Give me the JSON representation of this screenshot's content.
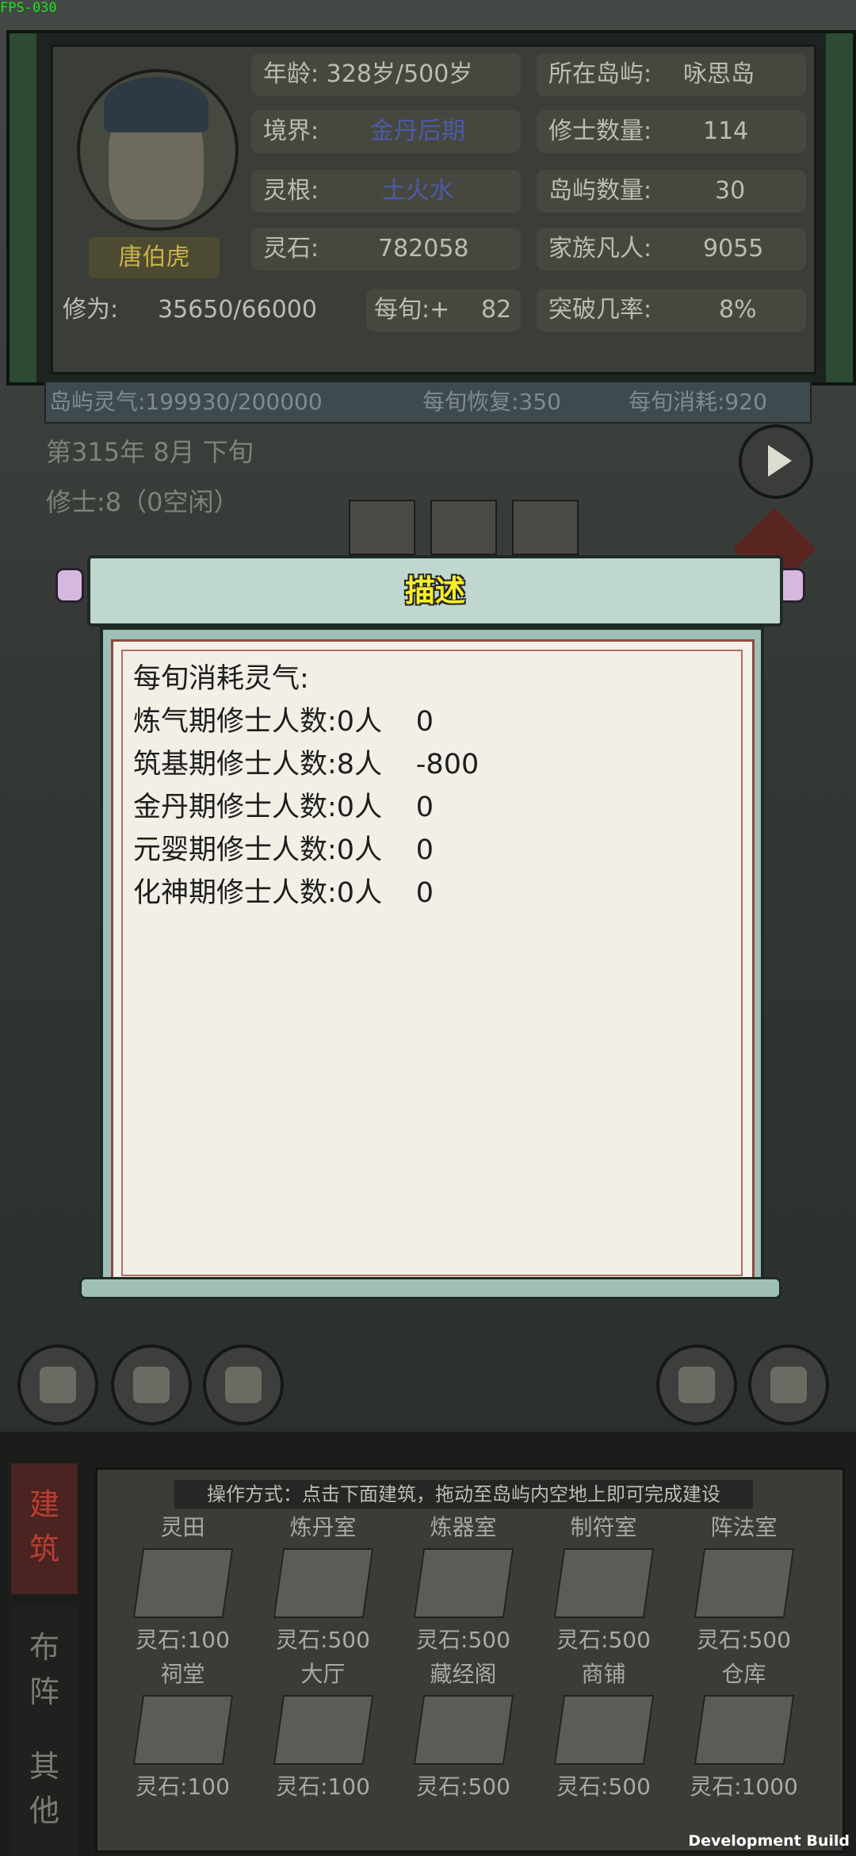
{
  "debug": {
    "fps": "FPS-030",
    "build": "Development Build"
  },
  "player": {
    "name": "唐伯虎",
    "age_label": "年龄",
    "age_value": "328岁/500岁",
    "realm_label": "境界:",
    "realm_value": "金丹后期",
    "root_label": "灵根:",
    "root_value": "土火水",
    "stones_label": "灵石:",
    "stones_value": "782058",
    "cult_label": "修为:",
    "cult_value": "35650/66000",
    "per_label": "每旬:+",
    "per_value": "82"
  },
  "island": {
    "loc_label": "所在岛屿:",
    "loc_value": "咏思岛",
    "cultivators_label": "修士数量:",
    "cultivators_value": "114",
    "islands_label": "岛屿数量:",
    "islands_value": "30",
    "mortals_label": "家族凡人:",
    "mortals_value": "9055",
    "breakthrough_label": "突破几率:",
    "breakthrough_value": "8%"
  },
  "aura": {
    "text": "岛屿灵气:199930/200000",
    "recover": "每旬恢复:350",
    "consume": "每旬消耗:920"
  },
  "date_text": "第315年 8月 下旬",
  "cultivator_text": "修士:8（0空闲）",
  "dialog": {
    "title": "描述",
    "heading": "每旬消耗灵气:",
    "rows": [
      {
        "label": "炼气期修士人数:",
        "count": "0人",
        "cost": "0"
      },
      {
        "label": "筑基期修士人数:",
        "count": "8人",
        "cost": "-800"
      },
      {
        "label": "金丹期修士人数:",
        "count": "0人",
        "cost": "0"
      },
      {
        "label": "元婴期修士人数:",
        "count": "0人",
        "cost": "0"
      },
      {
        "label": "化神期修士人数:",
        "count": "0人",
        "cost": "0"
      }
    ]
  },
  "tabs": {
    "build": "建筑",
    "array": "布阵",
    "other": "其他"
  },
  "build_hint": "操作方式：点击下面建筑，拖动至岛屿内空地上即可完成建设",
  "buildings": [
    {
      "name": "灵田",
      "cost": "灵石:100"
    },
    {
      "name": "炼丹室",
      "cost": "灵石:500"
    },
    {
      "name": "炼器室",
      "cost": "灵石:500"
    },
    {
      "name": "制符室",
      "cost": "灵石:500"
    },
    {
      "name": "阵法室",
      "cost": "灵石:500"
    },
    {
      "name": "祠堂",
      "cost": "灵石:100"
    },
    {
      "name": "大厅",
      "cost": "灵石:100"
    },
    {
      "name": "藏经阁",
      "cost": "灵石:500"
    },
    {
      "name": "商铺",
      "cost": "灵石:500"
    },
    {
      "name": "仓库",
      "cost": "灵石:1000"
    }
  ]
}
